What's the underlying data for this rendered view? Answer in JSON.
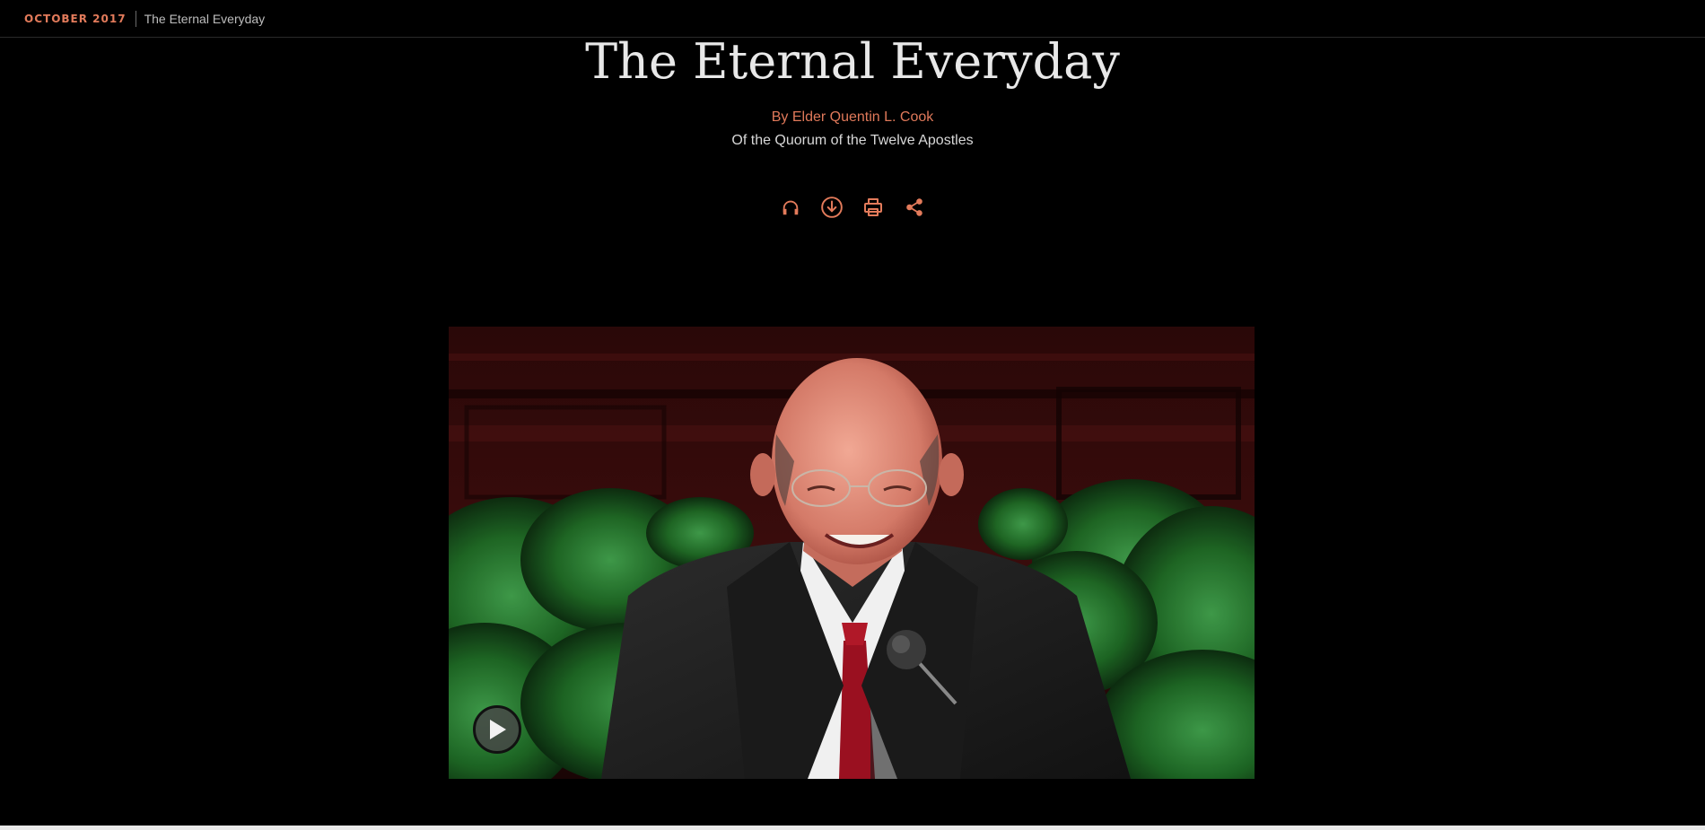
{
  "header": {
    "issue": "OCTOBER 2017",
    "breadcrumb_title": "The Eternal Everyday"
  },
  "article": {
    "title": "The Eternal Everyday",
    "author": "By Elder Quentin L. Cook",
    "role": "Of the Quorum of the Twelve Apostles"
  },
  "toolbar": {
    "icons": [
      "headphones-icon",
      "download-icon",
      "print-icon",
      "share-icon"
    ]
  },
  "media": {
    "play_icon": "play-icon"
  },
  "colors": {
    "accent": "#e37b5b",
    "background": "#000000",
    "text": "#d8d8d8"
  }
}
